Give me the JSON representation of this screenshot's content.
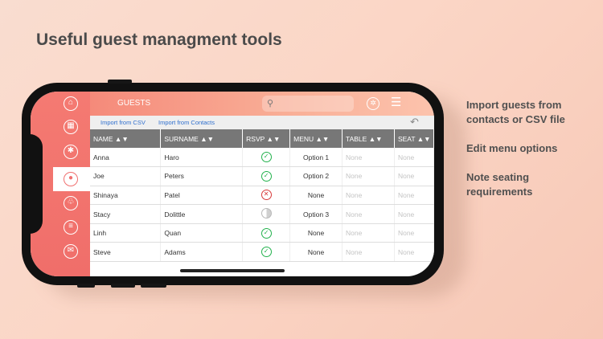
{
  "headline": "Useful guest managment tools",
  "features": [
    "Import guests  from contacts or CSV file",
    "Edit menu options",
    "Note seating requirements"
  ],
  "sidebar": {
    "icons": [
      "home-icon",
      "schedule-icon",
      "settings-asterisk-icon",
      "guests-icon",
      "gift-icon",
      "notes-icon",
      "message-icon"
    ],
    "active_index": 3
  },
  "topbar": {
    "title": "GUESTS",
    "search_placeholder": ""
  },
  "import": {
    "csv_label": "Import from CSV",
    "contacts_label": "Import from Contacts"
  },
  "table": {
    "columns": [
      "NAME ▲▼",
      "SURNAME ▲▼",
      "RSVP ▲▼",
      "MENU ▲▼",
      "TABLE ▲▼",
      "SEAT ▲▼"
    ],
    "rows": [
      {
        "name": "Anna",
        "surname": "Haro",
        "rsvp": "yes",
        "menu": "Option 1",
        "table": "None",
        "seat": "None"
      },
      {
        "name": "Joe",
        "surname": "Peters",
        "rsvp": "yes",
        "menu": "Option 2",
        "table": "None",
        "seat": "None"
      },
      {
        "name": "Shinaya",
        "surname": "Patel",
        "rsvp": "no",
        "menu": "None",
        "table": "None",
        "seat": "None"
      },
      {
        "name": "Stacy",
        "surname": "Dolittle",
        "rsvp": "maybe",
        "menu": "Option 3",
        "table": "None",
        "seat": "None"
      },
      {
        "name": "Linh",
        "surname": "Quan",
        "rsvp": "yes",
        "menu": "None",
        "table": "None",
        "seat": "None"
      },
      {
        "name": "Steve",
        "surname": "Adams",
        "rsvp": "yes",
        "menu": "None",
        "table": "None",
        "seat": "None"
      }
    ]
  },
  "colors": {
    "accent": "#f07070",
    "rsvp_yes": "#22b14c",
    "rsvp_no": "#d83a3a",
    "header_bg": "#777777"
  }
}
